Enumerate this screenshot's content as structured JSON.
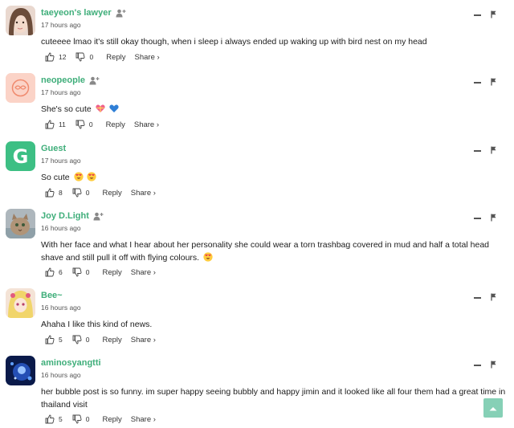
{
  "comments": [
    {
      "author": "taeyeon's lawyer",
      "time": "17 hours ago",
      "text": "cuteeee lmao it's still okay though, when i sleep i always ended up waking up with bird nest on my head",
      "likes": "12",
      "dislikes": "0",
      "avatar": "photo",
      "show_add_user": true
    },
    {
      "author": "neopeople",
      "time": "17 hours ago",
      "text": "She's so cute",
      "likes": "11",
      "dislikes": "0",
      "avatar": "pink-badge",
      "show_add_user": true
    },
    {
      "author": "Guest",
      "time": "17 hours ago",
      "text": "So cute",
      "likes": "8",
      "dislikes": "0",
      "avatar": "letter",
      "avatar_letter": "G",
      "show_add_user": false
    },
    {
      "author": "Joy D.Light",
      "time": "16 hours ago",
      "text": "With her face and what I hear about her personality she could wear a torn trashbag covered in mud and half a total head shave and still pull it off with flying colours.",
      "likes": "6",
      "dislikes": "0",
      "avatar": "cat-photo",
      "show_add_user": true
    },
    {
      "author": "Bee~",
      "time": "16 hours ago",
      "text": "Ahaha I like this kind of news.",
      "likes": "5",
      "dislikes": "0",
      "avatar": "anime",
      "show_add_user": false
    },
    {
      "author": "aminosyangtti",
      "time": "16 hours ago",
      "text": "her bubble post is so funny. im super happy seeing bubbly and happy jimin and it looked like all four them had a great time in thailand visit",
      "likes": "5",
      "dislikes": "0",
      "avatar": "blue-photo",
      "show_add_user": false
    }
  ],
  "labels": {
    "reply": "Reply",
    "share": "Share ›"
  },
  "colors": {
    "author": "#3fae7a",
    "guest_avatar": "#3dbf84",
    "scroll_top": "#86d0b6"
  },
  "icons": [
    "add-user-icon",
    "thumbs-up-icon",
    "thumbs-down-icon",
    "minimize-icon",
    "flag-icon",
    "scroll-top-icon",
    "heart-eyes-emoji",
    "gift-heart-emoji",
    "blue-heart-emoji"
  ]
}
